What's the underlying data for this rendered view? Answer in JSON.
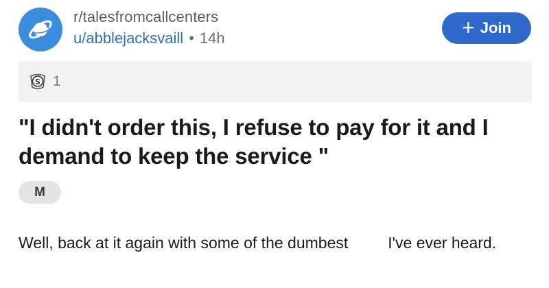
{
  "header": {
    "subreddit": "r/talesfromcallcenters",
    "username": "u/abblejacksvaill",
    "separator": "•",
    "time_ago": "14h",
    "avatar_icon": "planet-icon",
    "avatar_color": "#3b8ede"
  },
  "join_button": {
    "icon": "plus-icon",
    "plus_glyph": "+",
    "label": "Join",
    "color": "#2f69c9"
  },
  "awards": {
    "icon": "silver-award-icon",
    "count": "1"
  },
  "post": {
    "title": "\"I didn't order this, I refuse to pay for it and I demand to keep the service \"",
    "flair": "M",
    "body_part1": "Well, back at it again with some of the dumbest",
    "body_part2": "I've ever heard."
  }
}
